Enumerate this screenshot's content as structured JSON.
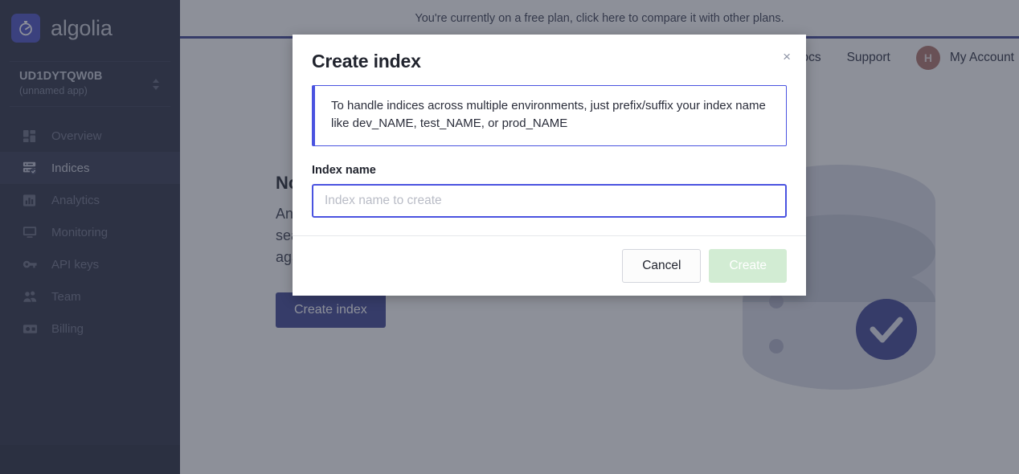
{
  "sidebar": {
    "brand_name": "algolia",
    "brand_icon": "algolia-logo-icon",
    "app_switcher": {
      "app_id": "UD1DYTQW0B",
      "app_subtitle": "(unnamed app)",
      "caret_icon": "caret-updown-icon"
    },
    "items": [
      {
        "label": "Overview",
        "icon": "dashboard-icon",
        "active": false
      },
      {
        "label": "Indices",
        "icon": "indices-icon",
        "active": true
      },
      {
        "label": "Analytics",
        "icon": "bar-chart-icon",
        "active": false
      },
      {
        "label": "Monitoring",
        "icon": "monitor-icon",
        "active": false
      },
      {
        "label": "API keys",
        "icon": "key-icon",
        "active": false
      },
      {
        "label": "Team",
        "icon": "people-icon",
        "active": false
      },
      {
        "label": "Billing",
        "icon": "billing-icon",
        "active": false
      }
    ]
  },
  "header": {
    "plan_banner": "You're currently on a free plan, click here to compare it with other plans.",
    "links": [
      "Docs",
      "Support"
    ],
    "avatar_initial": "H",
    "account_label": "My Account"
  },
  "main": {
    "empty_title": "No indices yet",
    "empty_desc": "An index stores the data you want to make searchable, the records that Algolia will run queries against (search).",
    "create_index_label": "Create index",
    "illustration_icon": "database-check-icon"
  },
  "modal": {
    "title": "Create index",
    "close_icon": "close-icon",
    "info_text": "To handle indices across multiple environments, just prefix/suffix your index name like dev_NAME, test_NAME, or prod_NAME",
    "field_label": "Index name",
    "input_value": "",
    "input_placeholder": "Index name to create",
    "cancel_label": "Cancel",
    "create_label": "Create"
  },
  "colors": {
    "sidebar_bg": "#2c3044",
    "accent_blue": "#3f4696",
    "focus_blue": "#4a53e0",
    "create_disabled_green": "#d2ecd3",
    "avatar_bg": "#b0736b"
  }
}
